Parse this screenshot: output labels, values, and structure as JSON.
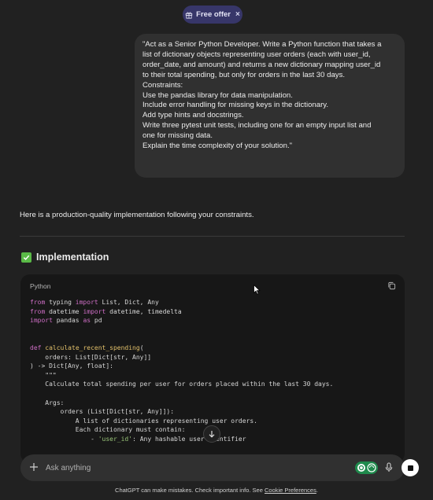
{
  "banner": {
    "label": "Free offer",
    "close": "×"
  },
  "user_message": {
    "lines": [
      "\"Act as a Senior Python Developer. Write a Python function that takes a",
      "list of dictionary objects representing user orders (each with user_id,",
      "order_date, and amount) and returns a new dictionary mapping user_id",
      "to their total spending, but only for orders in the last 30 days.",
      "Constraints:",
      "Use the pandas library for data manipulation.",
      "Include error handling for missing keys in the dictionary.",
      "Add type hints and docstrings.",
      "Write three pytest unit tests, including one for an empty input list and",
      "one for missing data.",
      "Explain the time complexity of your solution.\""
    ]
  },
  "assistant": {
    "intro": "Here is a production-quality implementation following your constraints.",
    "section_title": "Implementation"
  },
  "code_block": {
    "language": "Python",
    "lines": [
      "from typing import List, Dict, Any",
      "from datetime import datetime, timedelta",
      "import pandas as pd",
      "",
      "",
      "def calculate_recent_spending(",
      "    orders: List[Dict[str, Any]]",
      ") -> Dict[Any, float]:",
      "    \"\"\"",
      "    Calculate total spending per user for orders placed within the last 30 days.",
      "",
      "    Args:",
      "        orders (List[Dict[str, Any]]):",
      "            A list of dictionaries representing user orders.",
      "            Each dictionary must contain:",
      "                - 'user_id': Any hashable user identifier"
    ]
  },
  "composer": {
    "placeholder": "Ask anything"
  },
  "footer": {
    "text": "ChatGPT can make mistakes. Check important info. See ",
    "link": "Cookie Preferences",
    "suffix": "."
  },
  "icons": {
    "gift": "gift-icon",
    "copy": "copy-icon",
    "plus": "plus-icon",
    "mic": "microphone-icon",
    "stop": "stop-icon",
    "arrow": "arrow-down-icon",
    "check": "checkmark-icon"
  },
  "colors": {
    "background": "#212121",
    "bubble": "#303030",
    "code_bg": "#171717",
    "banner": "#373669",
    "check": "#5aba47",
    "extension": "#1f8a4c"
  }
}
